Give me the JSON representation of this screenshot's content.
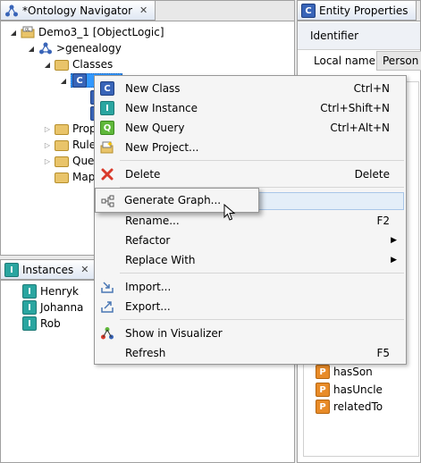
{
  "navigator": {
    "title": "*Ontology Navigator",
    "tree": {
      "project": "Demo3_1 [ObjectLogic]",
      "module": ">genealogy",
      "classes": "Classes",
      "properties": "Prop",
      "rules": "Rule",
      "queries": "Que",
      "mappings": "Map"
    }
  },
  "instances": {
    "title": "Instances",
    "items": [
      "Henryk",
      "Johanna",
      "Rob"
    ]
  },
  "entity": {
    "title": "Entity Properties",
    "identifier_label": "Identifier",
    "local_name_label": "Local name:",
    "local_name_value": "Person",
    "properties": [
      "hasSon",
      "hasUncle",
      "relatedTo"
    ]
  },
  "context_menu": {
    "new_class": {
      "label": "New Class",
      "shortcut": "Ctrl+N"
    },
    "new_instance": {
      "label": "New Instance",
      "shortcut": "Ctrl+Shift+N"
    },
    "new_query": {
      "label": "New Query",
      "shortcut": "Ctrl+Alt+N"
    },
    "new_project": {
      "label": "New Project..."
    },
    "delete": {
      "label": "Delete",
      "shortcut": "Delete"
    },
    "generate_graph": {
      "label": "Generate Graph..."
    },
    "rename": {
      "label": "Rename...",
      "shortcut": "F2"
    },
    "refactor": {
      "label": "Refactor"
    },
    "replace_with": {
      "label": "Replace With"
    },
    "import": {
      "label": "Import..."
    },
    "export": {
      "label": "Export..."
    },
    "show_in_visualizer": {
      "label": "Show in Visualizer"
    },
    "refresh": {
      "label": "Refresh",
      "shortcut": "F5"
    }
  },
  "icons": {
    "class": "class-icon",
    "instance": "instance-icon",
    "query": "query-icon",
    "property": "property-icon",
    "folder": "folder-icon"
  },
  "colors": {
    "class_icon": "#3864b8",
    "instance_icon": "#2aa5a0",
    "query_icon": "#5fb83a",
    "property_icon": "#e88b28",
    "delete_icon": "#d93a2b",
    "hover": "#e4eef8"
  }
}
